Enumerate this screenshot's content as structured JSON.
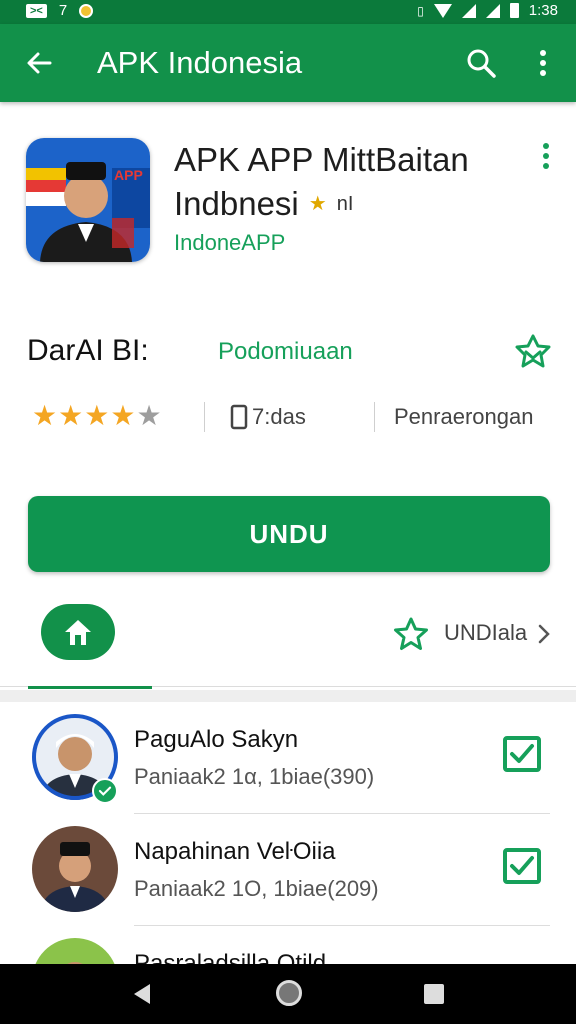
{
  "status_bar": {
    "left_icons": [
      "sim-icon",
      "notification-icon"
    ],
    "left_chip": "><",
    "left_number": "7",
    "time": "1:38"
  },
  "app_bar": {
    "title": "APK Indonesia",
    "color": "#12914a"
  },
  "app": {
    "title_line1": "APK APP MittBaitan",
    "title_line2": "Indbnesi",
    "badge_text": "nI",
    "developer": "IndoneAPP",
    "icon_label": "APP"
  },
  "meta": {
    "label": "DarAI BI:",
    "value": "Podomiuaan"
  },
  "stats": {
    "rating": 4.5,
    "stars": [
      "★",
      "★",
      "★",
      "★",
      "★"
    ],
    "size": "7:das",
    "rating_label": "Penraerongan"
  },
  "install_button": {
    "label": "UNDU",
    "color": "#0f9550"
  },
  "tabs": {
    "more_label": "UNDIala"
  },
  "list": {
    "items": [
      {
        "name": "PaguAlo Sakyn",
        "subtitle": "Paniaak2 1α, 1biae(390)",
        "checked": true,
        "verified": true
      },
      {
        "name": "Napahinan VeŀOiia",
        "subtitle": "Paniaak2 1Ο, 1biae(209)",
        "checked": true,
        "verified": false
      },
      {
        "name": "Pasraladsilla Otild",
        "subtitle": "",
        "checked": true,
        "verified": false
      }
    ]
  },
  "accent_green": "#16a05a"
}
